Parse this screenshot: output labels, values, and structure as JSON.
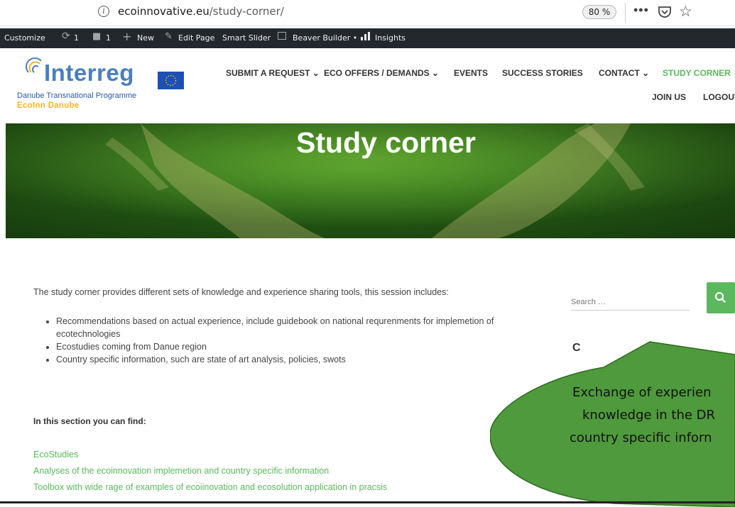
{
  "browser": {
    "url_domain": "ecoinnovative.eu",
    "url_path": "/study-corner/",
    "zoom": "80 %",
    "more_icon": "more-horizontal-icon",
    "pocket_icon": "pocket-icon",
    "bookmark_icon": "star-icon"
  },
  "admin_bar": {
    "customize": "Customize",
    "updates_count": "1",
    "comments_count": "1",
    "new": "New",
    "edit_page": "Edit Page",
    "smart_slider": "Smart Slider",
    "beaver_builder": "Beaver Builder •",
    "insights": "Insights"
  },
  "logo": {
    "brand": "Interreg",
    "programme": "Danube Transnational Programme",
    "project": "EcoInn Danube"
  },
  "nav": {
    "items": [
      {
        "label": "SUBMIT A REQUEST ⌄"
      },
      {
        "label": "ECO OFFERS / DEMANDS ⌄"
      },
      {
        "label": "EVENTS"
      },
      {
        "label": "SUCCESS STORIES"
      },
      {
        "label": "CONTACT ⌄"
      },
      {
        "label": "STUDY CORNER"
      },
      {
        "label": "JOIN US"
      },
      {
        "label": "LOGOUT"
      }
    ],
    "active_color": "#5cb85c"
  },
  "hero": {
    "title": "Study corner"
  },
  "content": {
    "intro": "The study corner provides different sets of knowledge and experience sharing tools, this session includes:",
    "bullets": [
      "Recommendations based on actual experience,  include guidebook on national requrenments for implemetion of ecotechnologies",
      "Ecostudies coming from Danue region",
      "Country specific information, such are state of art analysis, policies, swots"
    ],
    "section_title": "In this section you can find:",
    "links": [
      "EcoStudies",
      "Analyses of the ecoinnovation implemetion and country specific information",
      "Toolbox with wide rage of examples of ecoiinovation and ecosolution application in pracsis"
    ]
  },
  "sidebar": {
    "search_placeholder": "Search …",
    "search_icon": "search-icon",
    "heading_partial": "C"
  },
  "callout": {
    "lines": [
      "Exchange of experien",
      "knowledge in the DR",
      "country specific inforn"
    ],
    "fill": "#4f9a3c"
  }
}
